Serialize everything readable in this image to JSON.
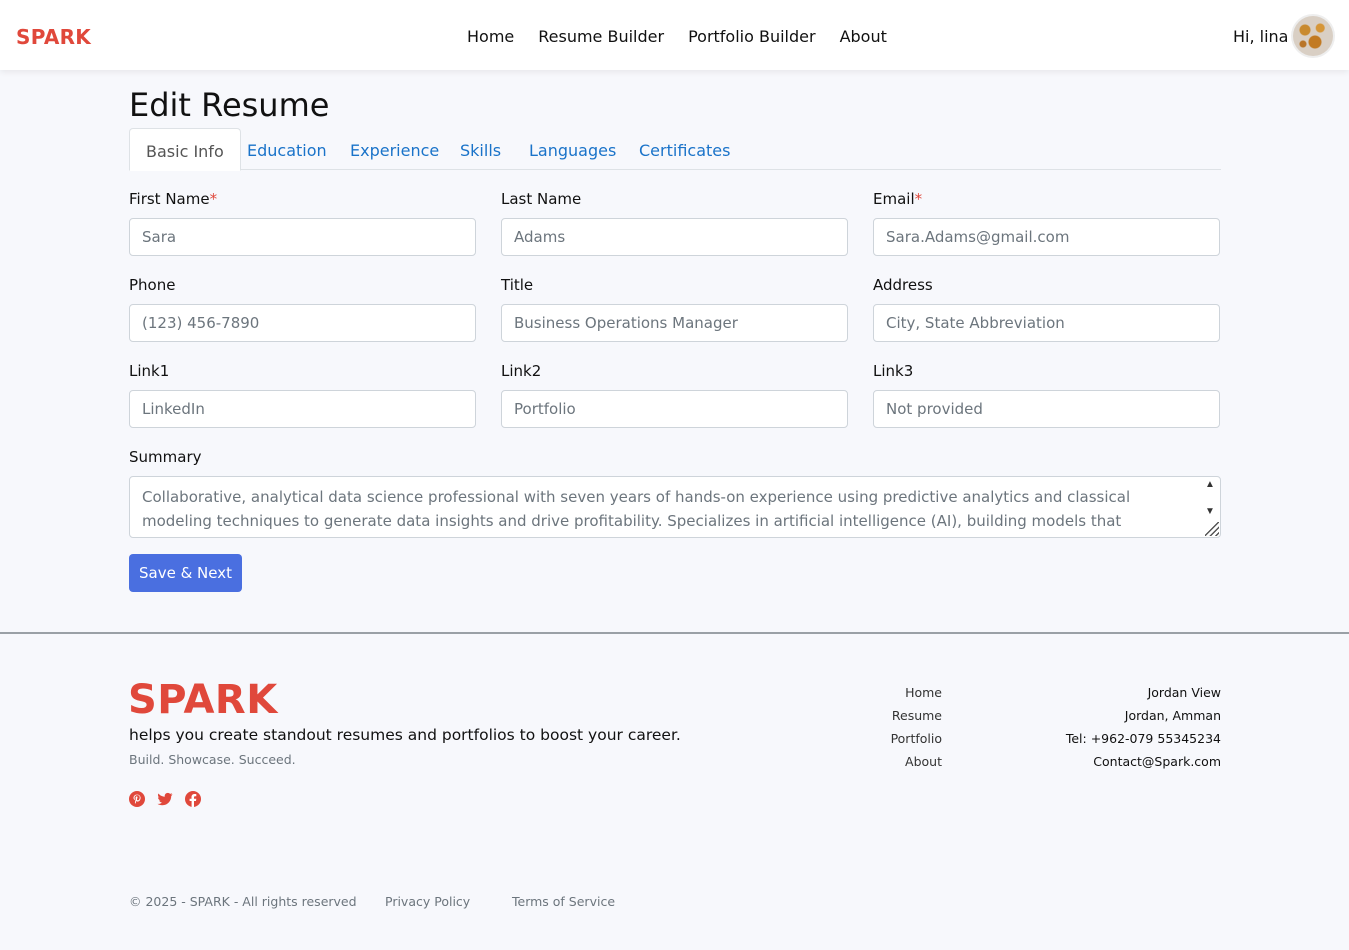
{
  "navbar": {
    "brand": "SPARK",
    "links": [
      "Home",
      "Resume Builder",
      "Portfolio Builder",
      "About"
    ],
    "greeting": "Hi, lina"
  },
  "page": {
    "title": "Edit Resume",
    "tabs": [
      "Basic Info",
      "Education",
      "Experience",
      "Skills",
      "Languages",
      "Certificates"
    ],
    "active_tab": "Basic Info"
  },
  "form": {
    "first_name": {
      "label": "First Name",
      "required_mark": "*",
      "value": "Sara"
    },
    "last_name": {
      "label": "Last Name",
      "value": "Adams"
    },
    "email": {
      "label": "Email",
      "required_mark": "*",
      "value": "Sara.Adams@gmail.com"
    },
    "phone": {
      "label": "Phone",
      "placeholder": "(123) 456-7890"
    },
    "title": {
      "label": "Title",
      "value": "Business Operations Manager"
    },
    "address": {
      "label": "Address",
      "placeholder": "City, State Abbreviation"
    },
    "link1": {
      "label": "Link1",
      "value": "LinkedIn"
    },
    "link2": {
      "label": "Link2",
      "value": "Portfolio"
    },
    "link3": {
      "label": "Link3",
      "value": "Not provided"
    },
    "summary": {
      "label": "Summary",
      "value": "Collaborative, analytical data science professional with seven years of hands-on experience using predictive analytics and classical modeling techniques to generate data insights and drive profitability. Specializes in artificial intelligence (AI), building models that emulate human intelligence"
    },
    "submit_label": "Save & Next"
  },
  "footer": {
    "brand": "SPARK",
    "tagline": "helps you create standout resumes and portfolios to boost your career.",
    "motto": "Build. Showcase. Succeed.",
    "social_icons": [
      "pinterest-icon",
      "twitter-icon",
      "facebook-icon"
    ],
    "links": [
      "Home",
      "Resume",
      "Portfolio",
      "About"
    ],
    "contact": [
      "Jordan View",
      "Jordan, Amman",
      "Tel: +962-079 55345234",
      "Contact@Spark.com"
    ],
    "copyright": "© 2025 - SPARK - All rights reserved",
    "privacy": "Privacy Policy",
    "terms": "Terms of Service"
  },
  "colors": {
    "brand": "#e0483b",
    "primary_button": "#4a6fe0",
    "tab_link": "#1a73c9",
    "background": "#f7f8fc"
  }
}
